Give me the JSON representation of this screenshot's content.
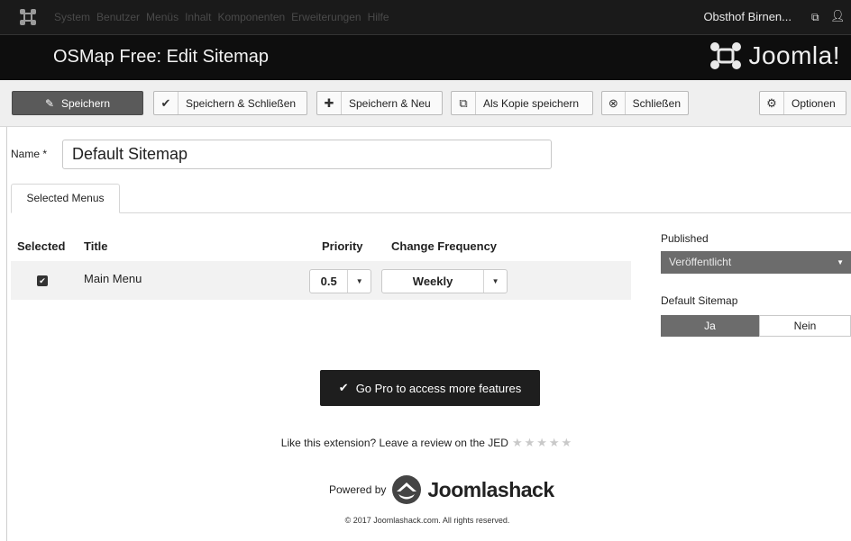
{
  "topnav": {
    "menu": [
      "System",
      "Benutzer",
      "Menüs",
      "Inhalt",
      "Komponenten",
      "Erweiterungen",
      "Hilfe"
    ],
    "site_name": "Obsthof Birnen...",
    "external_icon": "external-link-icon",
    "user_icon": "user-icon"
  },
  "header": {
    "title": "OSMap Free: Edit Sitemap",
    "brand": "Joomla!"
  },
  "toolbar": {
    "save": "Speichern",
    "save_close": "Speichern & Schließen",
    "save_new": "Speichern & Neu",
    "save_copy": "Als Kopie speichern",
    "close": "Schließen",
    "options": "Optionen"
  },
  "form": {
    "name_label": "Name *",
    "name_value": "Default Sitemap"
  },
  "tabs": [
    "Selected Menus"
  ],
  "table": {
    "headers": [
      "Selected",
      "Title",
      "Priority",
      "Change Frequency"
    ],
    "rows": [
      {
        "selected": true,
        "title": "Main Menu",
        "priority": "0.5",
        "frequency": "Weekly"
      }
    ]
  },
  "sidebar": {
    "published_label": "Published",
    "published_value": "Veröffentlicht",
    "default_label": "Default Sitemap",
    "default_yes": "Ja",
    "default_no": "Nein"
  },
  "footer": {
    "gopro": "Go Pro to access more features",
    "review": "Like this extension? Leave a review on the JED",
    "stars": "★★★★★",
    "powered_by": "Powered by",
    "brand": "Joomlashack",
    "copyright": "© 2017 Joomlashack.com. All rights reserved."
  },
  "colors": {
    "topbar": "#1a1a1a",
    "header": "#0e0e0e",
    "primary_button": "#5a5a5a",
    "select_bg": "#6c6c6c"
  }
}
